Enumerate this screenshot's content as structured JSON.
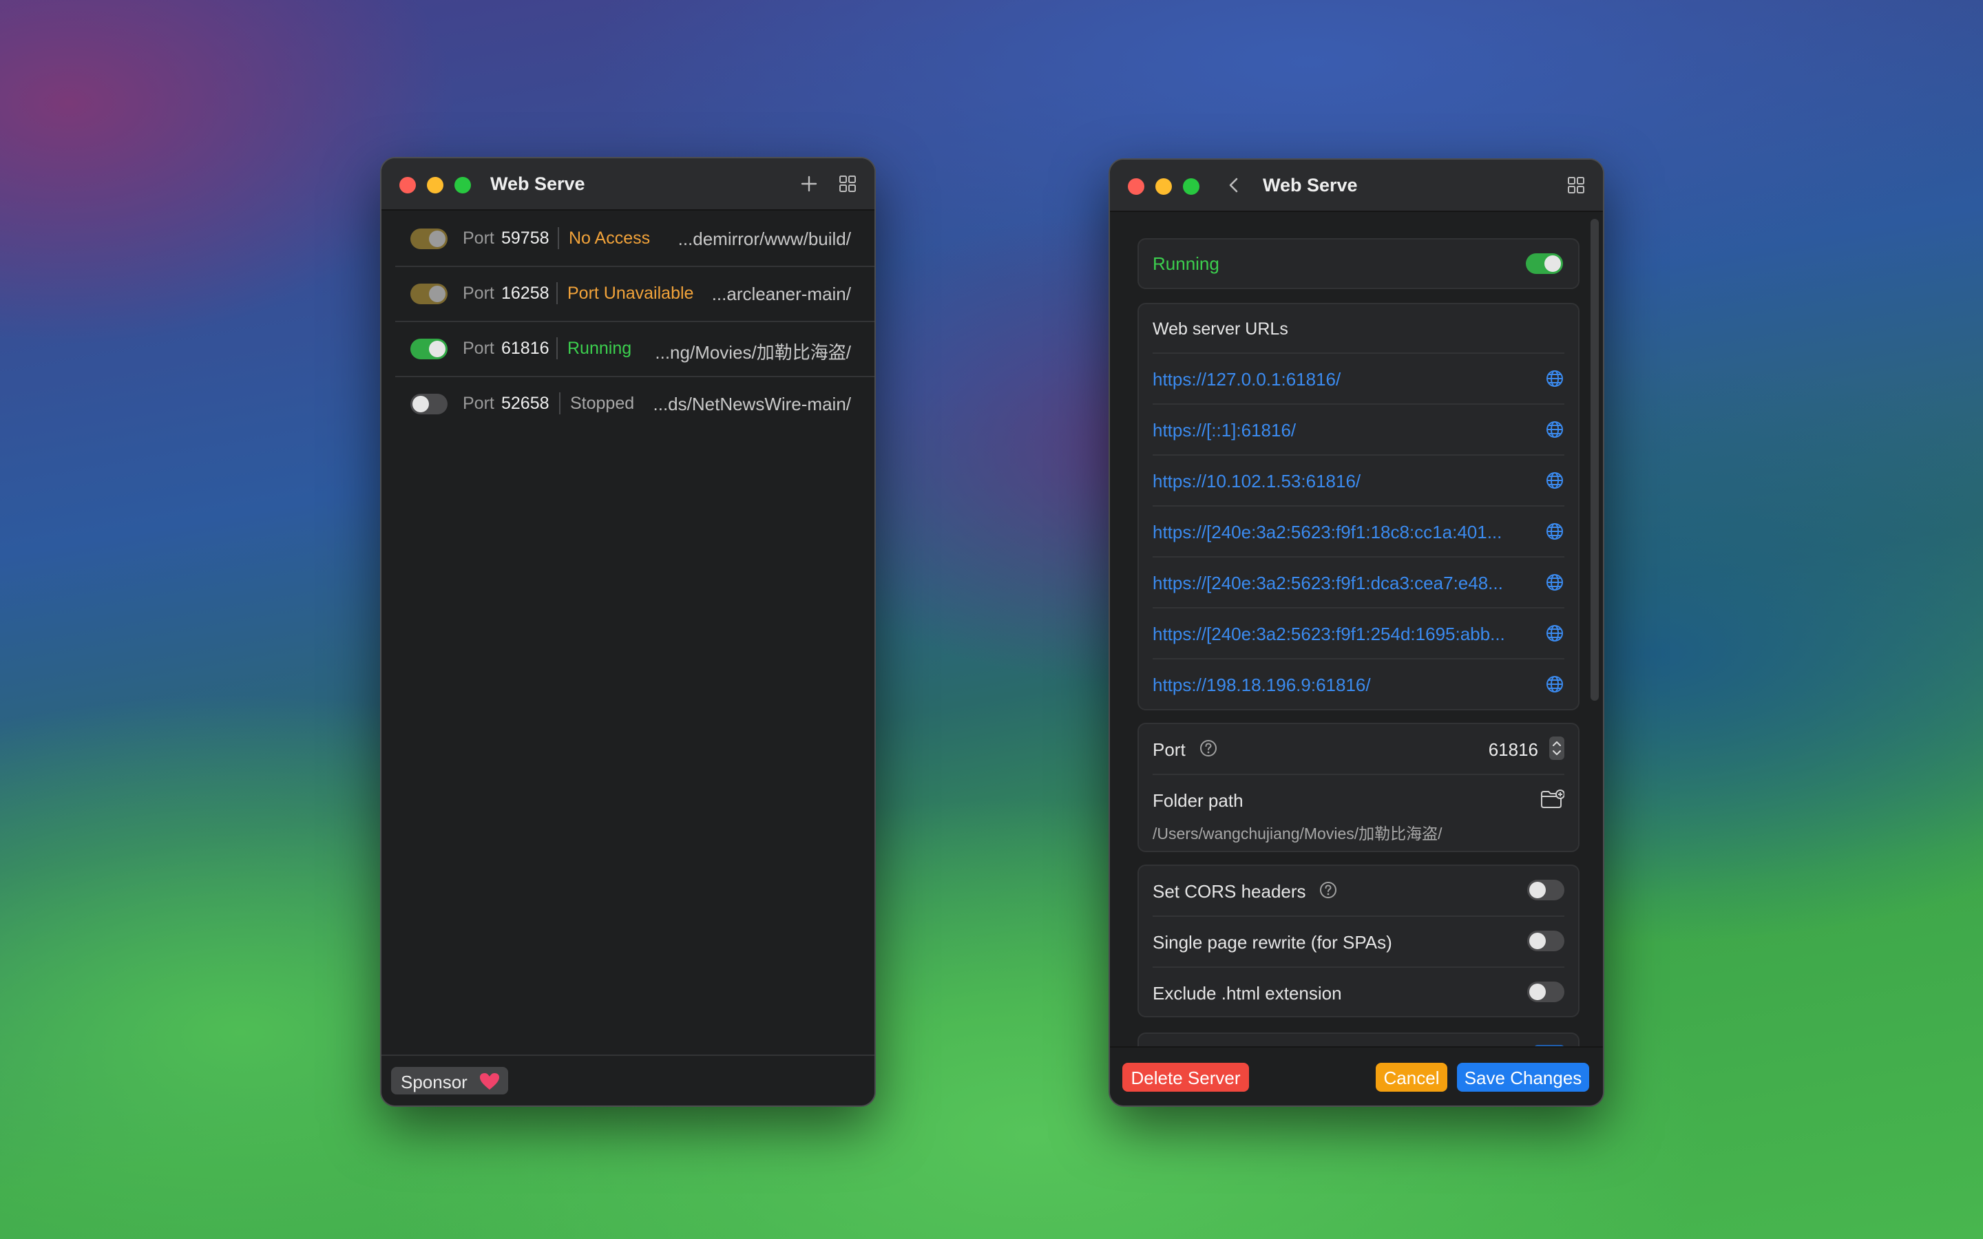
{
  "left_window": {
    "title": "Web Serve",
    "rows": [
      {
        "port_label": "Port",
        "port": "59758",
        "status": "No Access",
        "status_color": "#f2a33a",
        "path": "...demirror/www/build/",
        "toggle": "warn"
      },
      {
        "port_label": "Port",
        "port": "16258",
        "status": "Port Unavailable",
        "status_color": "#f2a33a",
        "path": "...arcleaner-main/",
        "toggle": "warn"
      },
      {
        "port_label": "Port",
        "port": "61816",
        "status": "Running",
        "status_color": "#3ccf4e",
        "path": "...ng/Movies/加勒比海盗/",
        "toggle": "on"
      },
      {
        "port_label": "Port",
        "port": "52658",
        "status": "Stopped",
        "status_color": "#a8a8a8",
        "path": "...ds/NetNewsWire-main/",
        "toggle": "off"
      }
    ],
    "sponsor_label": "Sponsor"
  },
  "right_window": {
    "title": "Web Serve",
    "running_label": "Running",
    "urls_header": "Web server URLs",
    "urls": [
      "https://127.0.0.1:61816/",
      "https://[::1]:61816/",
      "https://10.102.1.53:61816/",
      "https://[240e:3a2:5623:f9f1:18c8:cc1a:401...",
      "https://[240e:3a2:5623:f9f1:dca3:cea7:e48...",
      "https://[240e:3a2:5623:f9f1:254d:1695:abb...",
      "https://198.18.196.9:61816/"
    ],
    "port_label": "Port",
    "port_value": "61816",
    "folder_label": "Folder path",
    "folder_path": "/Users/wangchujiang/Movies/加勒比海盗/",
    "cors_label": "Set CORS headers",
    "spa_label": "Single page rewrite (for SPAs)",
    "html_ext_label": "Exclude .html extension",
    "delete_label": "Delete Server",
    "cancel_label": "Cancel",
    "save_label": "Save Changes"
  },
  "colors": {
    "accent_blue": "#1f7cf0",
    "link_blue": "#3b8bf0",
    "running_green": "#3ccf4e",
    "warning_orange": "#f2a33a",
    "delete_red": "#f0483e",
    "cancel_orange": "#f5a00f"
  }
}
